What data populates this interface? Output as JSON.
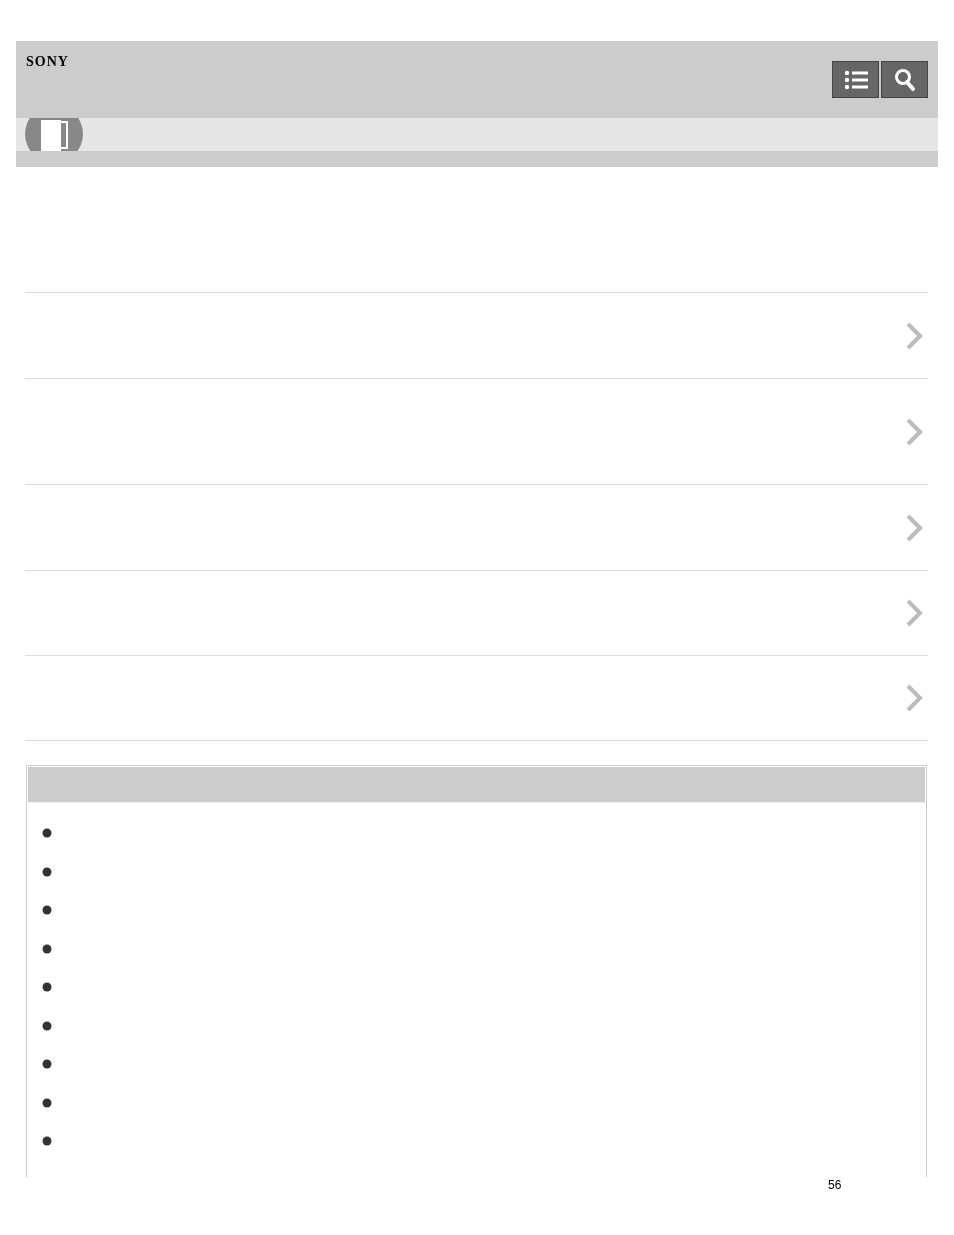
{
  "header": {
    "logo": "SONY"
  },
  "page_number": "56"
}
